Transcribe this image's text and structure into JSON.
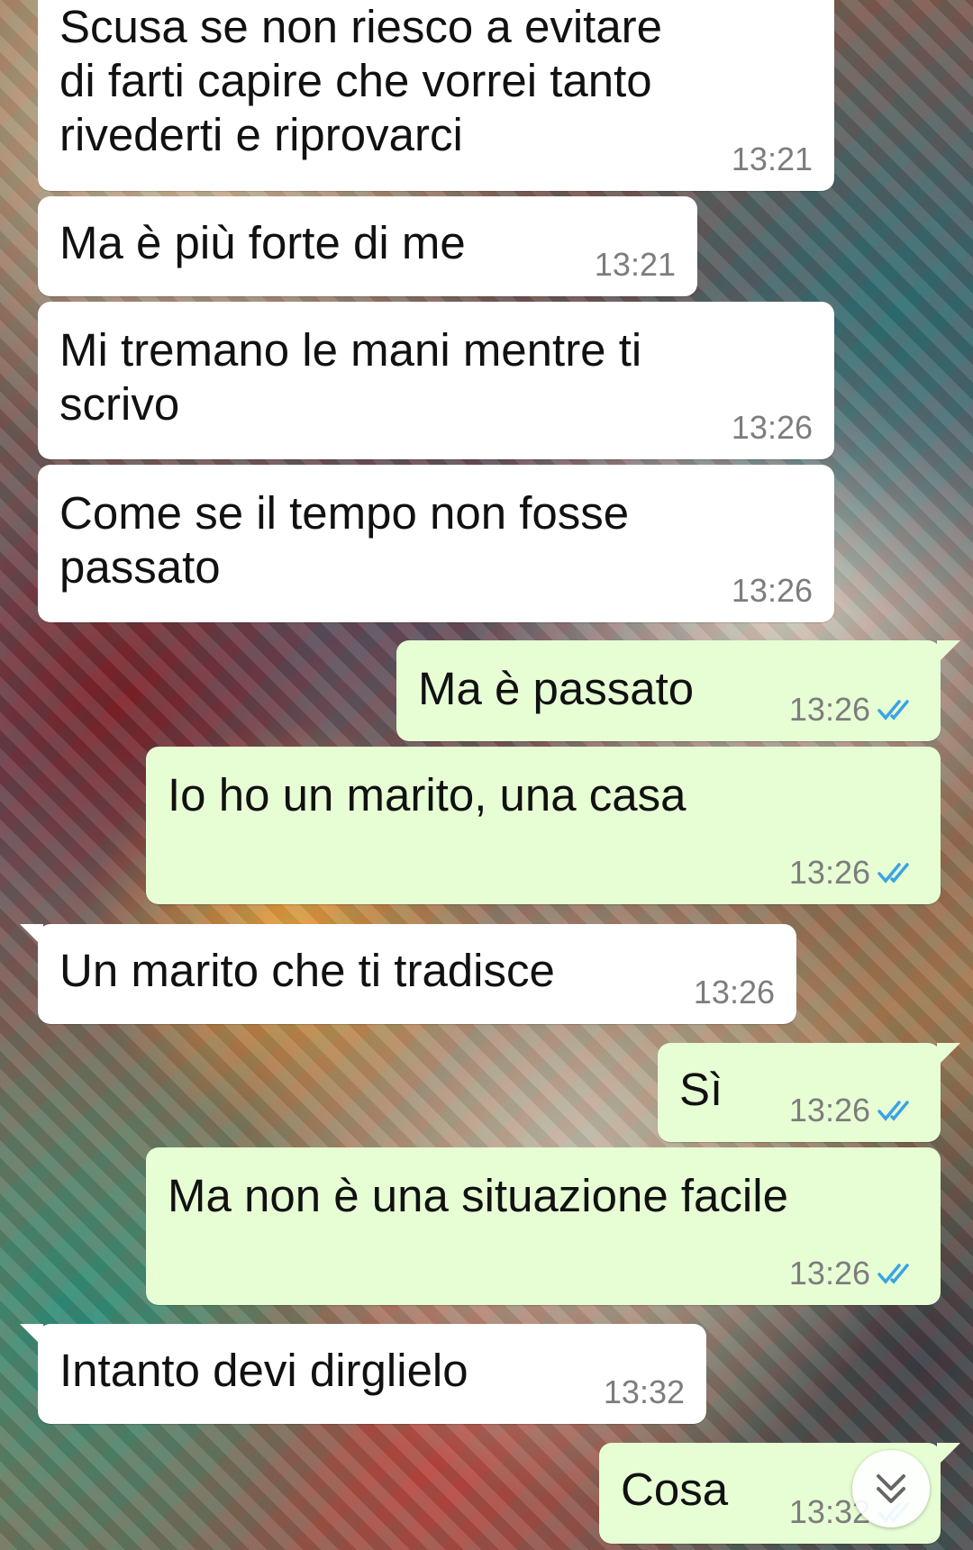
{
  "messages": [
    {
      "direction": "in",
      "text": "Scusa se non riesco a evitare\ndi farti capire che vorrei tanto\nrivederti e riprovarci",
      "time": "13:21"
    },
    {
      "direction": "in",
      "text": "Ma è più forte di me",
      "time": "13:21"
    },
    {
      "direction": "in",
      "text": "Mi tremano le mani mentre ti\nscrivo",
      "time": "13:26"
    },
    {
      "direction": "in",
      "text": "Come se il tempo non fosse\npassato",
      "time": "13:26"
    },
    {
      "direction": "out",
      "text": "Ma è passato",
      "time": "13:26",
      "status": "read"
    },
    {
      "direction": "out",
      "text": "Io ho un marito, una casa",
      "time": "13:26",
      "status": "read"
    },
    {
      "direction": "in",
      "text": "Un marito che ti tradisce",
      "time": "13:26"
    },
    {
      "direction": "out",
      "text": "Sì",
      "time": "13:26",
      "status": "read"
    },
    {
      "direction": "out",
      "text": "Ma non è una situazione facile",
      "time": "13:26",
      "status": "read"
    },
    {
      "direction": "in",
      "text": "Intanto devi dirglielo",
      "time": "13:32"
    },
    {
      "direction": "out",
      "text": "Cosa",
      "time": "13:32",
      "status": "read"
    }
  ],
  "icons": {
    "read_ticks": "double-check-icon",
    "scroll_down": "chevron-double-down-icon"
  },
  "colors": {
    "incoming_bubble": "#ffffff",
    "outgoing_bubble": "#e7fed5",
    "read_ticks": "#3aa3e3",
    "timestamp": "#7d7d7d"
  }
}
